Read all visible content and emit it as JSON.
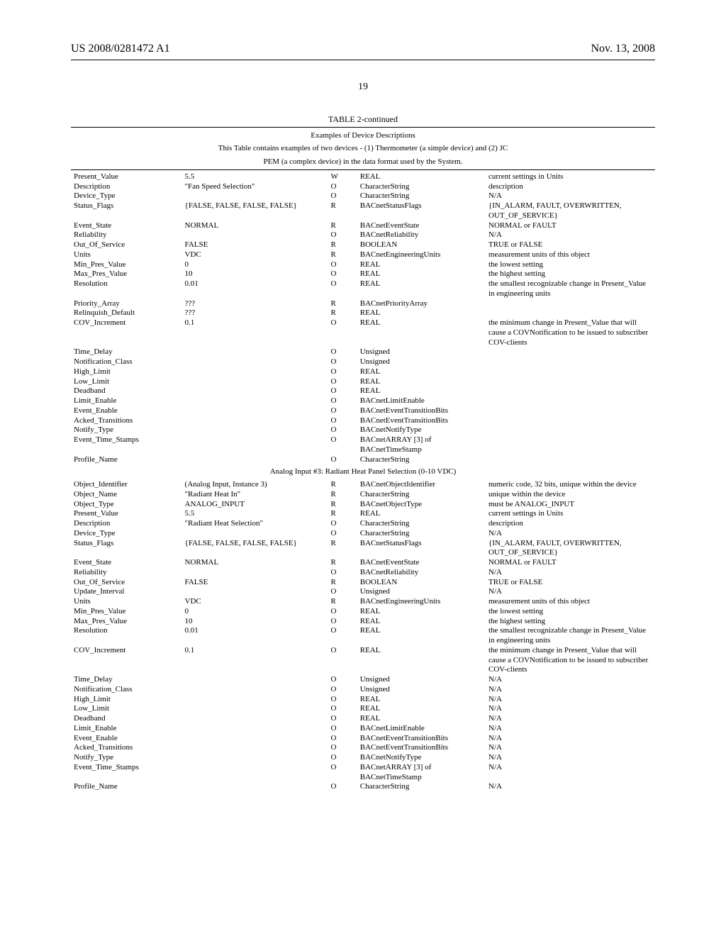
{
  "header": {
    "left": "US 2008/0281472 A1",
    "right": "Nov. 13, 2008",
    "page": "19"
  },
  "table": {
    "title": "TABLE 2-continued",
    "caption_line1": "Examples of Device Descriptions",
    "caption_line2": "This Table contains examples of two devices - (1) Thermometer (a simple device) and (2) JC",
    "caption_line3": "PEM (a complex device) in the data format used by the System."
  },
  "section1_rows": [
    {
      "c1": "Present_Value",
      "c2": "5.5",
      "c3": "W",
      "c4": "REAL",
      "c5": "current settings in Units"
    },
    {
      "c1": "Description",
      "c2": "\"Fan Speed Selection\"",
      "c3": "O",
      "c4": "CharacterString",
      "c5": "description"
    },
    {
      "c1": "Device_Type",
      "c2": "",
      "c3": "O",
      "c4": "CharacterString",
      "c5": "N/A"
    },
    {
      "c1": "Status_Flags",
      "c2": "{FALSE, FALSE, FALSE, FALSE}",
      "c3": "R",
      "c4": "BACnetStatusFlags",
      "c5": "{IN_ALARM, FAULT, OVERWRITTEN, OUT_OF_SERVICE}"
    },
    {
      "c1": "Event_State",
      "c2": "NORMAL",
      "c3": "R",
      "c4": "BACnetEventState",
      "c5": "NORMAL or FAULT"
    },
    {
      "c1": "Reliability",
      "c2": "",
      "c3": "O",
      "c4": "BACnetReliability",
      "c5": "N/A"
    },
    {
      "c1": "Out_Of_Service",
      "c2": "FALSE",
      "c3": "R",
      "c4": "BOOLEAN",
      "c5": "TRUE or FALSE"
    },
    {
      "c1": "Units",
      "c2": "VDC",
      "c3": "R",
      "c4": "BACnetEngineeringUnits",
      "c5": "measurement units of this object"
    },
    {
      "c1": "Min_Pres_Value",
      "c2": "0",
      "c3": "O",
      "c4": "REAL",
      "c5": "the lowest setting"
    },
    {
      "c1": "Max_Pres_Value",
      "c2": "10",
      "c3": "O",
      "c4": "REAL",
      "c5": "the highest setting"
    },
    {
      "c1": "Resolution",
      "c2": "0.01",
      "c3": "O",
      "c4": "REAL",
      "c5": "the smallest recognizable change in Present_Value in engineering units"
    },
    {
      "c1": "Priority_Array",
      "c2": "???",
      "c3": "R",
      "c4": "BACnetPriorityArray",
      "c5": ""
    },
    {
      "c1": "Relinquish_Default",
      "c2": "???",
      "c3": "R",
      "c4": "REAL",
      "c5": ""
    },
    {
      "c1": "COV_Increment",
      "c2": "0.1",
      "c3": "O",
      "c4": "REAL",
      "c5": "the minimum change in Present_Value that will cause a COVNotification to be issued to subscriber COV-clients"
    },
    {
      "c1": "Time_Delay",
      "c2": "",
      "c3": "O",
      "c4": "Unsigned",
      "c5": ""
    },
    {
      "c1": "Notification_Class",
      "c2": "",
      "c3": "O",
      "c4": "Unsigned",
      "c5": ""
    },
    {
      "c1": "High_Limit",
      "c2": "",
      "c3": "O",
      "c4": "REAL",
      "c5": ""
    },
    {
      "c1": "Low_Limit",
      "c2": "",
      "c3": "O",
      "c4": "REAL",
      "c5": ""
    },
    {
      "c1": "Deadband",
      "c2": "",
      "c3": "O",
      "c4": "REAL",
      "c5": ""
    },
    {
      "c1": "Limit_Enable",
      "c2": "",
      "c3": "O",
      "c4": "BACnetLimitEnable",
      "c5": ""
    },
    {
      "c1": "Event_Enable",
      "c2": "",
      "c3": "O",
      "c4": "BACnetEventTransitionBits",
      "c5": ""
    },
    {
      "c1": "Acked_Transitions",
      "c2": "",
      "c3": "O",
      "c4": "BACnetEventTransitionBits",
      "c5": ""
    },
    {
      "c1": "Notify_Type",
      "c2": "",
      "c3": "O",
      "c4": "BACnetNotifyType",
      "c5": ""
    },
    {
      "c1": "Event_Time_Stamps",
      "c2": "",
      "c3": "O",
      "c4": "BACnetARRAY [3] of BACnetTimeStamp",
      "c5": ""
    },
    {
      "c1": "Profile_Name",
      "c2": "",
      "c3": "O",
      "c4": "CharacterString",
      "c5": ""
    }
  ],
  "section2_heading": "Analog Input #3: Radiant Heat Panel Selection (0-10 VDC)",
  "section2_rows": [
    {
      "c1": "Object_Identifier",
      "c2": "(Analog Input, Instance 3)",
      "c3": "R",
      "c4": "BACnetObjectIdentifier",
      "c5": "numeric code, 32 bits, unique within the device"
    },
    {
      "c1": "Object_Name",
      "c2": "\"Radiant Heat In\"",
      "c3": "R",
      "c4": "CharacterString",
      "c5": "unique within the device"
    },
    {
      "c1": "Object_Type",
      "c2": "ANALOG_INPUT",
      "c3": "R",
      "c4": "BACnetObjectType",
      "c5": "must be ANALOG_INPUT"
    },
    {
      "c1": "Present_Value",
      "c2": "5.5",
      "c3": "R",
      "c4": "REAL",
      "c5": "current settings in Units"
    },
    {
      "c1": "Description",
      "c2": "\"Radiant Heat Selection\"",
      "c3": "O",
      "c4": "CharacterString",
      "c5": "description"
    },
    {
      "c1": "Device_Type",
      "c2": "",
      "c3": "O",
      "c4": "CharacterString",
      "c5": "N/A"
    },
    {
      "c1": "Status_Flags",
      "c2": "{FALSE, FALSE, FALSE, FALSE}",
      "c3": "R",
      "c4": "BACnetStatusFlags",
      "c5": "{IN_ALARM, FAULT, OVERWRITTEN, OUT_OF_SERVICE}"
    },
    {
      "c1": "Event_State",
      "c2": "NORMAL",
      "c3": "R",
      "c4": "BACnetEventState",
      "c5": "NORMAL or FAULT"
    },
    {
      "c1": "Reliability",
      "c2": "",
      "c3": "O",
      "c4": "BACnetReliability",
      "c5": "N/A"
    },
    {
      "c1": "Out_Of_Service",
      "c2": "FALSE",
      "c3": "R",
      "c4": "BOOLEAN",
      "c5": "TRUE or FALSE"
    },
    {
      "c1": "Update_Interval",
      "c2": "",
      "c3": "O",
      "c4": "Unsigned",
      "c5": "N/A"
    },
    {
      "c1": "Units",
      "c2": "VDC",
      "c3": "R",
      "c4": "BACnetEngineeringUnits",
      "c5": "measurement units of this object"
    },
    {
      "c1": "Min_Pres_Value",
      "c2": "0",
      "c3": "O",
      "c4": "REAL",
      "c5": "the lowest setting"
    },
    {
      "c1": "Max_Pres_Value",
      "c2": "10",
      "c3": "O",
      "c4": "REAL",
      "c5": "the highest setting"
    },
    {
      "c1": "Resolution",
      "c2": "0.01",
      "c3": "O",
      "c4": "REAL",
      "c5": "the smallest recognizable change in Present_Value in engineering units"
    },
    {
      "c1": "COV_Increment",
      "c2": "0.1",
      "c3": "O",
      "c4": "REAL",
      "c5": "the minimum change in Present_Value that will cause a COVNotification to be issued to subscriber COV-clients"
    },
    {
      "c1": "Time_Delay",
      "c2": "",
      "c3": "O",
      "c4": "Unsigned",
      "c5": "N/A"
    },
    {
      "c1": "Notification_Class",
      "c2": "",
      "c3": "O",
      "c4": "Unsigned",
      "c5": "N/A"
    },
    {
      "c1": "High_Limit",
      "c2": "",
      "c3": "O",
      "c4": "REAL",
      "c5": "N/A"
    },
    {
      "c1": "Low_Limit",
      "c2": "",
      "c3": "O",
      "c4": "REAL",
      "c5": "N/A"
    },
    {
      "c1": "Deadband",
      "c2": "",
      "c3": "O",
      "c4": "REAL",
      "c5": "N/A"
    },
    {
      "c1": "Limit_Enable",
      "c2": "",
      "c3": "O",
      "c4": "BACnetLimitEnable",
      "c5": "N/A"
    },
    {
      "c1": "Event_Enable",
      "c2": "",
      "c3": "O",
      "c4": "BACnetEventTransitionBits",
      "c5": "N/A"
    },
    {
      "c1": "Acked_Transitions",
      "c2": "",
      "c3": "O",
      "c4": "BACnetEventTransitionBits",
      "c5": "N/A"
    },
    {
      "c1": "Notify_Type",
      "c2": "",
      "c3": "O",
      "c4": "BACnetNotifyType",
      "c5": "N/A"
    },
    {
      "c1": "Event_Time_Stamps",
      "c2": "",
      "c3": "O",
      "c4": "BACnetARRAY [3] of BACnetTimeStamp",
      "c5": "N/A"
    },
    {
      "c1": "Profile_Name",
      "c2": "",
      "c3": "O",
      "c4": "CharacterString",
      "c5": "N/A"
    }
  ]
}
